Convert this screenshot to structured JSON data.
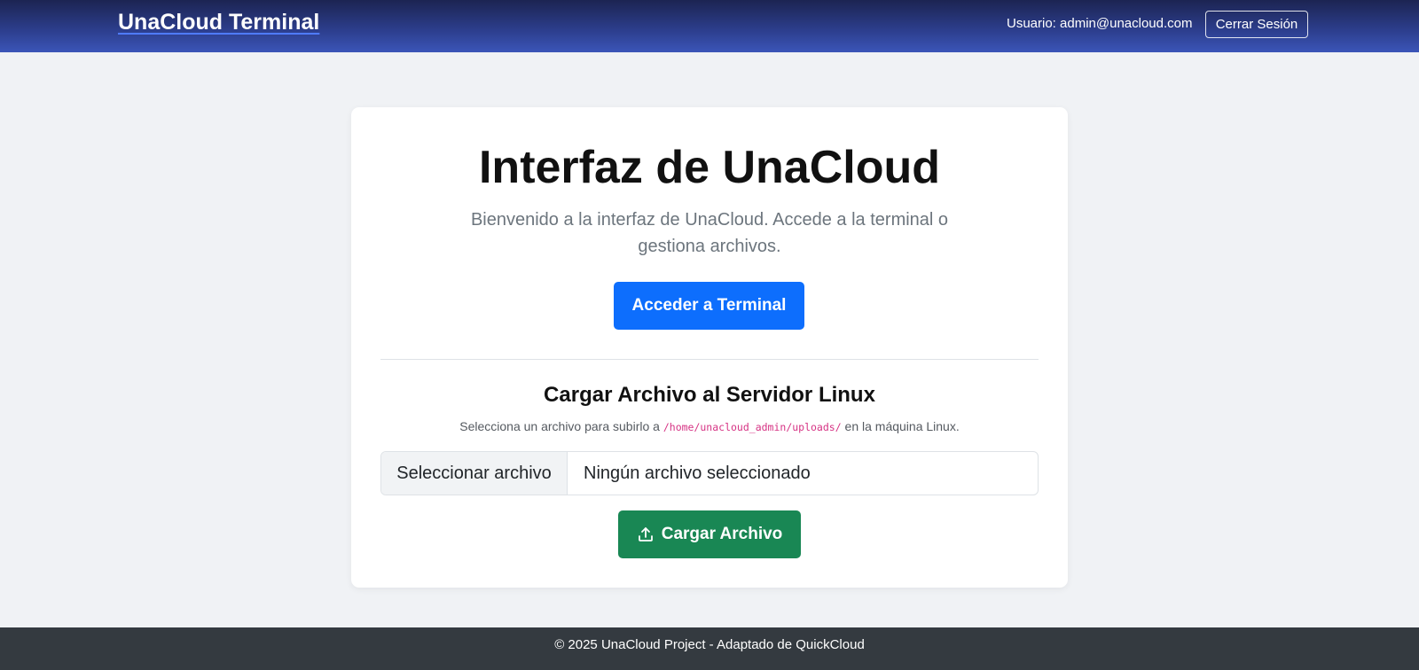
{
  "navbar": {
    "brand": "UnaCloud Terminal",
    "user_label": "Usuario: admin@unacloud.com",
    "logout_label": "Cerrar Sesión"
  },
  "main": {
    "title": "Interfaz de UnaCloud",
    "lead": "Bienvenido a la interfaz de UnaCloud. Accede a la terminal o gestiona archivos.",
    "terminal_button": "Acceder a Terminal"
  },
  "upload": {
    "title": "Cargar Archivo al Servidor Linux",
    "desc_prefix": "Selecciona un archivo para subirlo a",
    "desc_path": "/home/unacloud_admin/uploads/",
    "desc_suffix": "en la máquina Linux.",
    "file_button": "Seleccionar archivo",
    "file_status": "Ningún archivo seleccionado",
    "upload_button": "Cargar Archivo",
    "upload_icon": "upload-icon"
  },
  "footer": {
    "text": "© 2025 UnaCloud Project - Adaptado de QuickCloud"
  },
  "colors": {
    "primary": "#0d6efd",
    "success": "#198754",
    "navbar": "#2d3f8f",
    "footer": "#343a40"
  }
}
